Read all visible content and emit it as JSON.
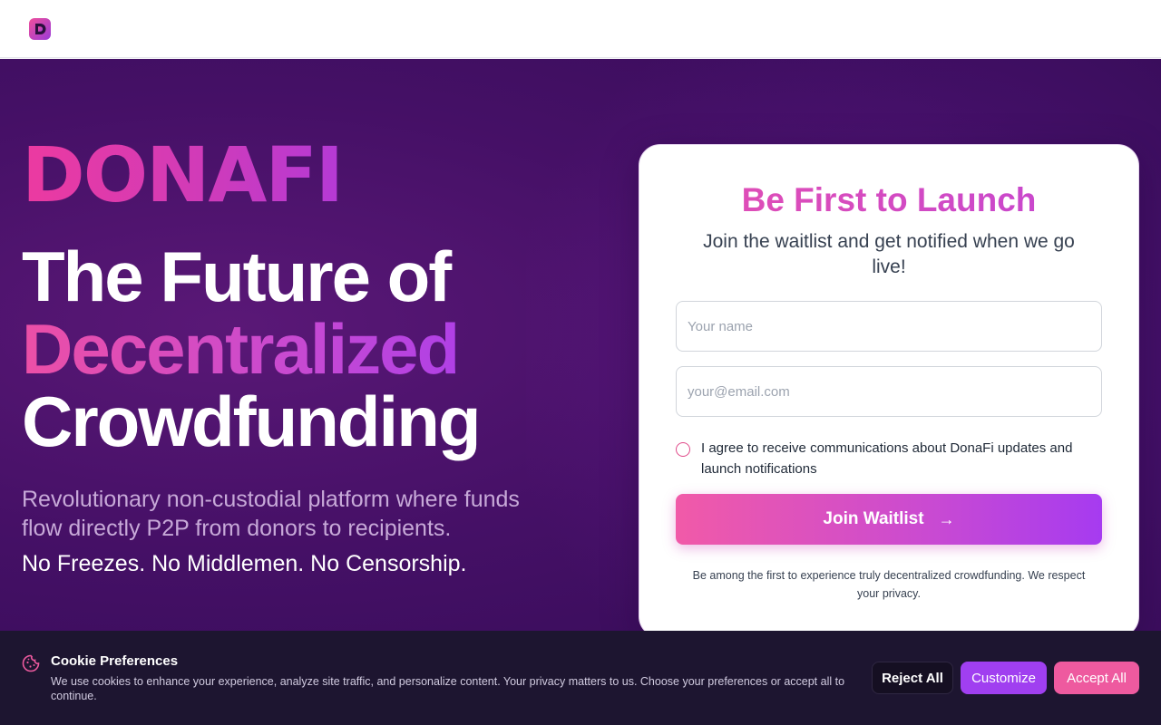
{
  "header": {
    "logo_icon": "donafi-logo-icon"
  },
  "hero": {
    "brand": "DONAFI",
    "headline_line1": "The Future of",
    "headline_line2": "Decentralized",
    "headline_line3": "Crowdfunding",
    "subtitle": "Revolutionary non-custodial platform where funds flow directly P2P from donors to recipients.",
    "tagline": "No Freezes. No Middlemen. No Censorship."
  },
  "waitlist": {
    "title": "Be First to Launch",
    "subtitle": "Join the waitlist and get notified when we go live!",
    "name_placeholder": "Your name",
    "email_placeholder": "your@email.com",
    "consent_label": "I agree to receive communications about DonaFi updates and launch notifications",
    "button_label": "Join Waitlist",
    "button_icon": "arrow-right-icon",
    "note": "Be among the first to experience truly decentralized crowdfunding. We respect your privacy."
  },
  "cookie_banner": {
    "icon": "cookie-icon",
    "title": "Cookie Preferences",
    "text": "We use cookies to enhance your experience, analyze site traffic, and personalize content. Your privacy matters to us. Choose your preferences or accept all to continue.",
    "reject_label": "Reject All",
    "customize_label": "Customize",
    "accept_label": "Accept All"
  },
  "colors": {
    "brand_pink": "#ec3aa0",
    "brand_purple": "#a63bf0",
    "hero_bg": "#451066",
    "cookie_bg": "#1d1530"
  }
}
